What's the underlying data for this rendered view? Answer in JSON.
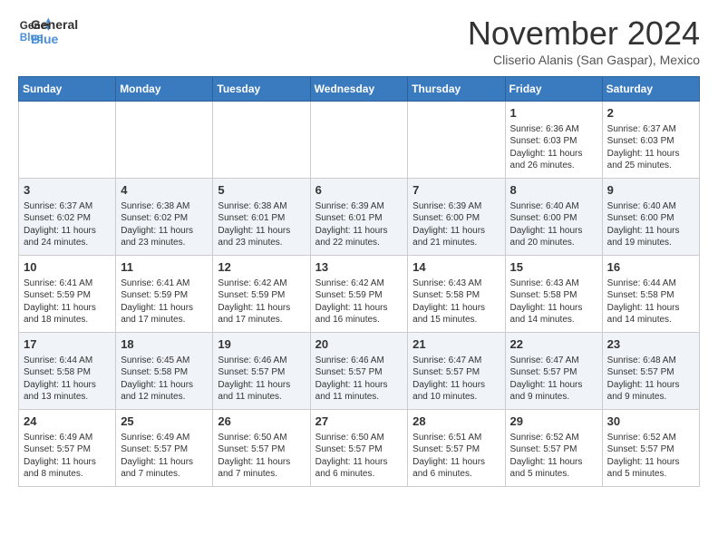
{
  "logo": {
    "line1": "General",
    "line2": "Blue"
  },
  "title": "November 2024",
  "subtitle": "Cliserio Alanis (San Gaspar), Mexico",
  "days_of_week": [
    "Sunday",
    "Monday",
    "Tuesday",
    "Wednesday",
    "Thursday",
    "Friday",
    "Saturday"
  ],
  "weeks": [
    [
      {
        "day": "",
        "info": ""
      },
      {
        "day": "",
        "info": ""
      },
      {
        "day": "",
        "info": ""
      },
      {
        "day": "",
        "info": ""
      },
      {
        "day": "",
        "info": ""
      },
      {
        "day": "1",
        "info": "Sunrise: 6:36 AM\nSunset: 6:03 PM\nDaylight: 11 hours and 26 minutes."
      },
      {
        "day": "2",
        "info": "Sunrise: 6:37 AM\nSunset: 6:03 PM\nDaylight: 11 hours and 25 minutes."
      }
    ],
    [
      {
        "day": "3",
        "info": "Sunrise: 6:37 AM\nSunset: 6:02 PM\nDaylight: 11 hours and 24 minutes."
      },
      {
        "day": "4",
        "info": "Sunrise: 6:38 AM\nSunset: 6:02 PM\nDaylight: 11 hours and 23 minutes."
      },
      {
        "day": "5",
        "info": "Sunrise: 6:38 AM\nSunset: 6:01 PM\nDaylight: 11 hours and 23 minutes."
      },
      {
        "day": "6",
        "info": "Sunrise: 6:39 AM\nSunset: 6:01 PM\nDaylight: 11 hours and 22 minutes."
      },
      {
        "day": "7",
        "info": "Sunrise: 6:39 AM\nSunset: 6:00 PM\nDaylight: 11 hours and 21 minutes."
      },
      {
        "day": "8",
        "info": "Sunrise: 6:40 AM\nSunset: 6:00 PM\nDaylight: 11 hours and 20 minutes."
      },
      {
        "day": "9",
        "info": "Sunrise: 6:40 AM\nSunset: 6:00 PM\nDaylight: 11 hours and 19 minutes."
      }
    ],
    [
      {
        "day": "10",
        "info": "Sunrise: 6:41 AM\nSunset: 5:59 PM\nDaylight: 11 hours and 18 minutes."
      },
      {
        "day": "11",
        "info": "Sunrise: 6:41 AM\nSunset: 5:59 PM\nDaylight: 11 hours and 17 minutes."
      },
      {
        "day": "12",
        "info": "Sunrise: 6:42 AM\nSunset: 5:59 PM\nDaylight: 11 hours and 17 minutes."
      },
      {
        "day": "13",
        "info": "Sunrise: 6:42 AM\nSunset: 5:59 PM\nDaylight: 11 hours and 16 minutes."
      },
      {
        "day": "14",
        "info": "Sunrise: 6:43 AM\nSunset: 5:58 PM\nDaylight: 11 hours and 15 minutes."
      },
      {
        "day": "15",
        "info": "Sunrise: 6:43 AM\nSunset: 5:58 PM\nDaylight: 11 hours and 14 minutes."
      },
      {
        "day": "16",
        "info": "Sunrise: 6:44 AM\nSunset: 5:58 PM\nDaylight: 11 hours and 14 minutes."
      }
    ],
    [
      {
        "day": "17",
        "info": "Sunrise: 6:44 AM\nSunset: 5:58 PM\nDaylight: 11 hours and 13 minutes."
      },
      {
        "day": "18",
        "info": "Sunrise: 6:45 AM\nSunset: 5:58 PM\nDaylight: 11 hours and 12 minutes."
      },
      {
        "day": "19",
        "info": "Sunrise: 6:46 AM\nSunset: 5:57 PM\nDaylight: 11 hours and 11 minutes."
      },
      {
        "day": "20",
        "info": "Sunrise: 6:46 AM\nSunset: 5:57 PM\nDaylight: 11 hours and 11 minutes."
      },
      {
        "day": "21",
        "info": "Sunrise: 6:47 AM\nSunset: 5:57 PM\nDaylight: 11 hours and 10 minutes."
      },
      {
        "day": "22",
        "info": "Sunrise: 6:47 AM\nSunset: 5:57 PM\nDaylight: 11 hours and 9 minutes."
      },
      {
        "day": "23",
        "info": "Sunrise: 6:48 AM\nSunset: 5:57 PM\nDaylight: 11 hours and 9 minutes."
      }
    ],
    [
      {
        "day": "24",
        "info": "Sunrise: 6:49 AM\nSunset: 5:57 PM\nDaylight: 11 hours and 8 minutes."
      },
      {
        "day": "25",
        "info": "Sunrise: 6:49 AM\nSunset: 5:57 PM\nDaylight: 11 hours and 7 minutes."
      },
      {
        "day": "26",
        "info": "Sunrise: 6:50 AM\nSunset: 5:57 PM\nDaylight: 11 hours and 7 minutes."
      },
      {
        "day": "27",
        "info": "Sunrise: 6:50 AM\nSunset: 5:57 PM\nDaylight: 11 hours and 6 minutes."
      },
      {
        "day": "28",
        "info": "Sunrise: 6:51 AM\nSunset: 5:57 PM\nDaylight: 11 hours and 6 minutes."
      },
      {
        "day": "29",
        "info": "Sunrise: 6:52 AM\nSunset: 5:57 PM\nDaylight: 11 hours and 5 minutes."
      },
      {
        "day": "30",
        "info": "Sunrise: 6:52 AM\nSunset: 5:57 PM\nDaylight: 11 hours and 5 minutes."
      }
    ]
  ]
}
